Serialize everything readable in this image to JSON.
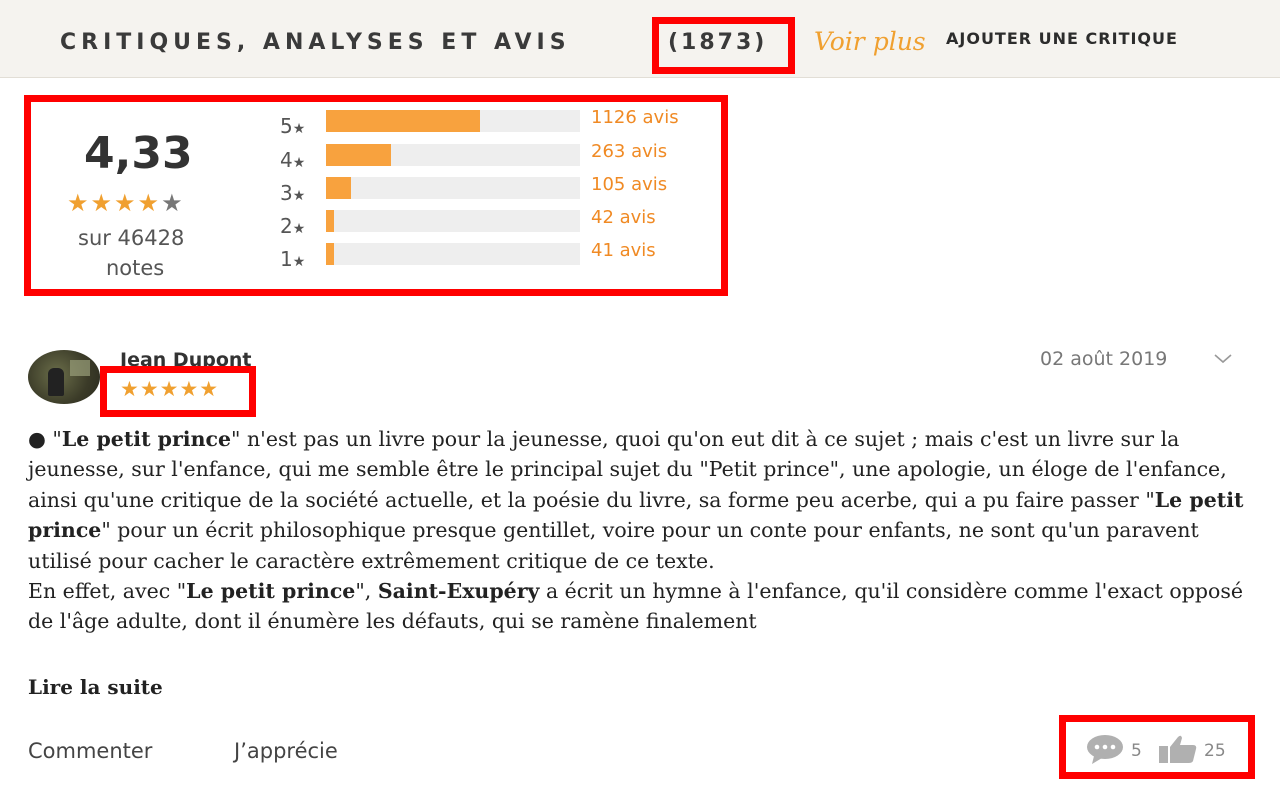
{
  "header": {
    "title": "CRITIQUES, ANALYSES ET AVIS",
    "count": "(1873)",
    "see_more": "Voir plus",
    "add_review": "AJOUTER UNE CRITIQUE"
  },
  "rating": {
    "average": "4,33",
    "average_stars": 4.33,
    "sur_label": "sur 46428",
    "notes_label": "notes",
    "star_glyph": "★",
    "distribution": [
      {
        "stars": "5",
        "count": "1126 avis",
        "fraction": 0.605
      },
      {
        "stars": "4",
        "count": "263 avis",
        "fraction": 0.255
      },
      {
        "stars": "3",
        "count": "105 avis",
        "fraction": 0.1
      },
      {
        "stars": "2",
        "count": "42 avis",
        "fraction": 0.03
      },
      {
        "stars": "1",
        "count": "41 avis",
        "fraction": 0.03
      }
    ]
  },
  "review": {
    "author": "Jean Dupont",
    "stars": "★★★★★",
    "rating": 5,
    "date": "02 août 2019",
    "read_more": "Lire la suite",
    "actions": {
      "comment": "Commenter",
      "like": "J’apprécie"
    },
    "stats": {
      "comments": "5",
      "likes": "25"
    }
  },
  "colors": {
    "accent": "#f8a23e",
    "highlight": "#ff0000",
    "header_bg": "#f5f3ef"
  },
  "icons": [
    "chevron-down-icon",
    "comment-icon",
    "thumbs-up-icon",
    "star-icon"
  ]
}
